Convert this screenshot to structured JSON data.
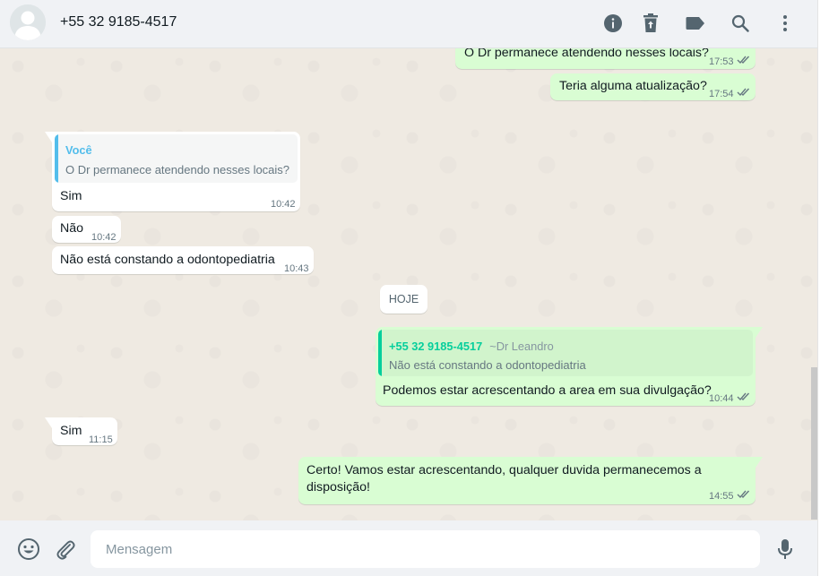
{
  "header": {
    "contact_name": "+55 32 9185-4517",
    "icons": [
      "info-icon",
      "delete-icon",
      "label-icon",
      "search-icon",
      "menu-icon"
    ]
  },
  "messages": [
    {
      "direction": "out",
      "text": "O Dr permanece atendendo nesses locais?",
      "time": "17:53",
      "status": "read"
    },
    {
      "direction": "out",
      "text": "Teria alguma atualização?",
      "time": "17:54",
      "status": "read"
    },
    {
      "direction": "in",
      "quote_author": "Você",
      "quote_text": "O Dr permanece atendendo nesses locais?",
      "text": "Sim",
      "time": "10:42"
    },
    {
      "direction": "in",
      "text": "Não",
      "time": "10:42"
    },
    {
      "direction": "in",
      "text": "Não está constando a odontopediatria",
      "time": "10:43"
    },
    {
      "day_label": "HOJE"
    },
    {
      "direction": "out",
      "quote_author": "+55 32 9185-4517",
      "quote_author_sub": "~Dr Leandro",
      "quote_text": "Não está constando a odontopediatria",
      "text": "Podemos estar acrescentando a area em sua divulgação?",
      "time": "10:44",
      "status": "read"
    },
    {
      "direction": "in",
      "text": "Sim",
      "time": "11:15"
    },
    {
      "direction": "out",
      "text_line1": "Certo! Vamos estar acrescentando, qualquer duvida permanecemos a",
      "text_line2": "disposição!",
      "time": "14:55",
      "status": "read"
    }
  ],
  "colors": {
    "header_bg": "#f0f2f5",
    "chat_bg": "#efeae2",
    "bubble_in": "#ffffff",
    "bubble_out": "#d9fdd3",
    "quote_you": "#53bdeb",
    "quote_contact": "#06cf9c",
    "tick": "#667781"
  },
  "composer": {
    "placeholder": "Mensagem",
    "icons": [
      "emoji-icon",
      "attach-icon",
      "mic-icon"
    ]
  }
}
